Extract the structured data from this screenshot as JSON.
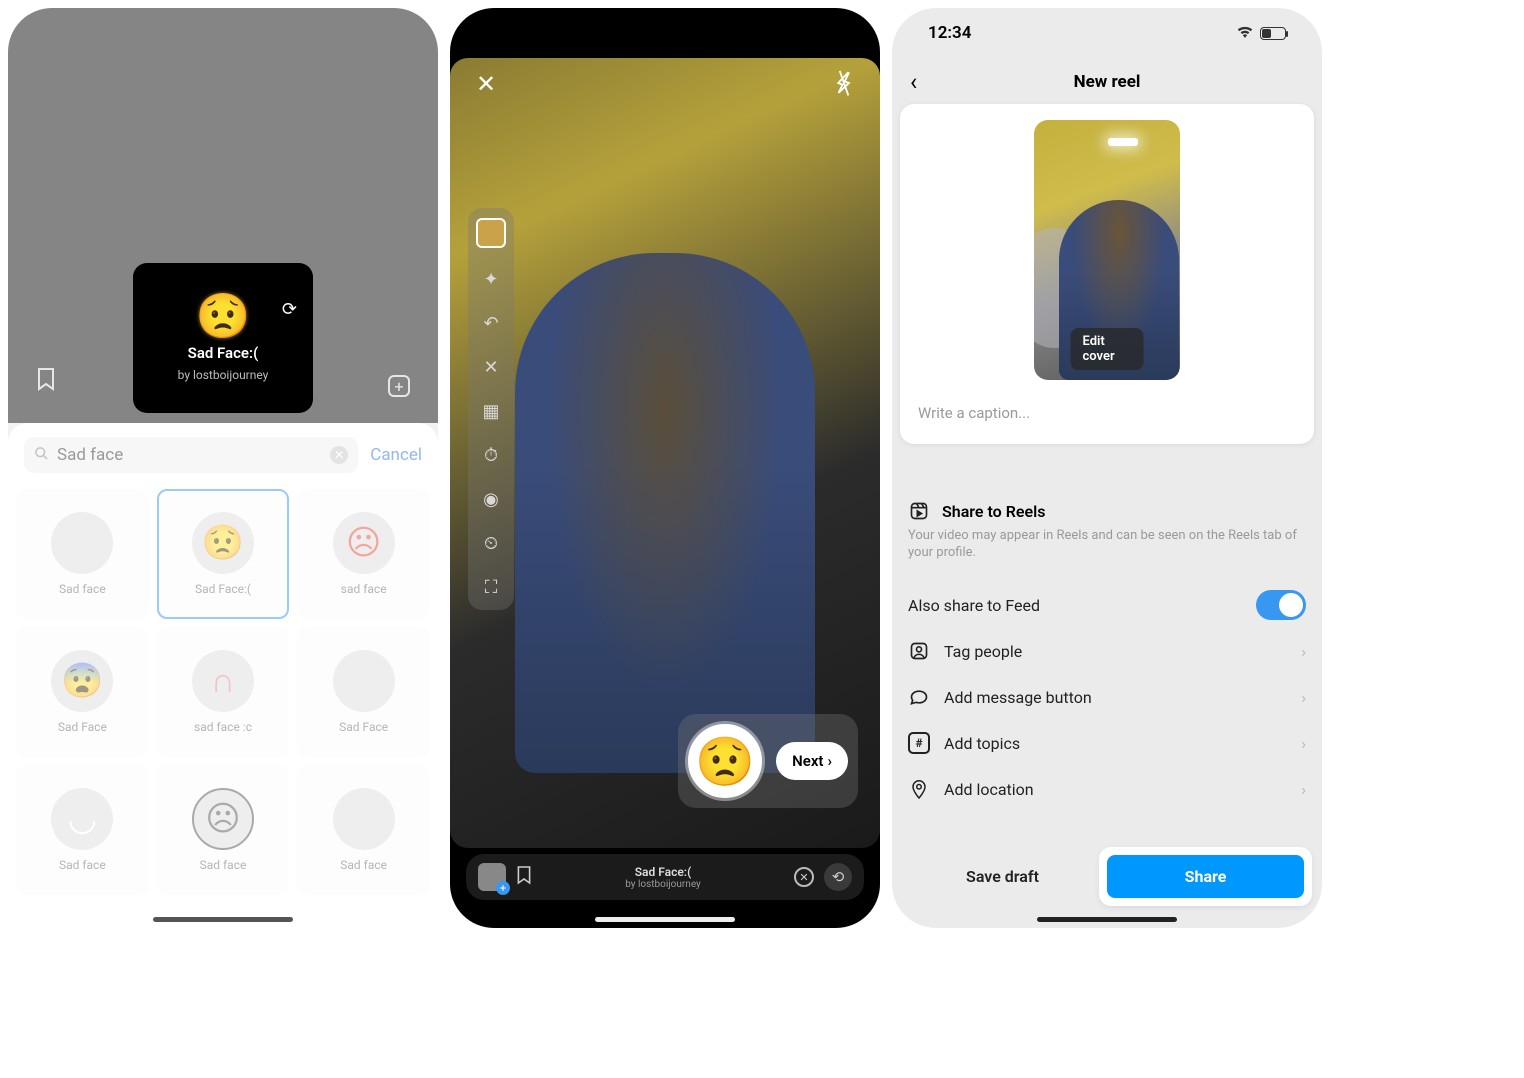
{
  "screen1": {
    "effect": {
      "title": "Sad Face:(",
      "author": "by lostboijourney"
    },
    "search": {
      "query": "Sad face",
      "cancel": "Cancel"
    },
    "effects": [
      {
        "label": "Sad face",
        "glyph": ""
      },
      {
        "label": "Sad Face:(",
        "glyph": "😟"
      },
      {
        "label": "sad face",
        "glyph": "☹"
      },
      {
        "label": "Sad Face",
        "glyph": "😨"
      },
      {
        "label": "sad face :c",
        "glyph": "∩"
      },
      {
        "label": "Sad Face",
        "glyph": ""
      },
      {
        "label": "Sad face",
        "glyph": "◡"
      },
      {
        "label": "Sad face",
        "glyph": "☹"
      },
      {
        "label": "Sad face",
        "glyph": ""
      }
    ]
  },
  "screen2": {
    "next": "Next",
    "effect_bar": {
      "title": "Sad Face:(",
      "author": "by lostboijourney"
    }
  },
  "screen3": {
    "status_time": "12:34",
    "battery_text": "39",
    "nav_title": "New reel",
    "edit_cover": "Edit cover",
    "caption_placeholder": "Write a caption...",
    "share_reels_title": "Share to Reels",
    "share_reels_desc": "Your video may appear in Reels and can be seen on the Reels tab of your profile.",
    "also_feed": "Also share to Feed",
    "rows": {
      "tag_people": "Tag people",
      "add_message": "Add message button",
      "add_topics": "Add topics",
      "add_location": "Add location"
    },
    "save_draft": "Save draft",
    "share": "Share"
  }
}
